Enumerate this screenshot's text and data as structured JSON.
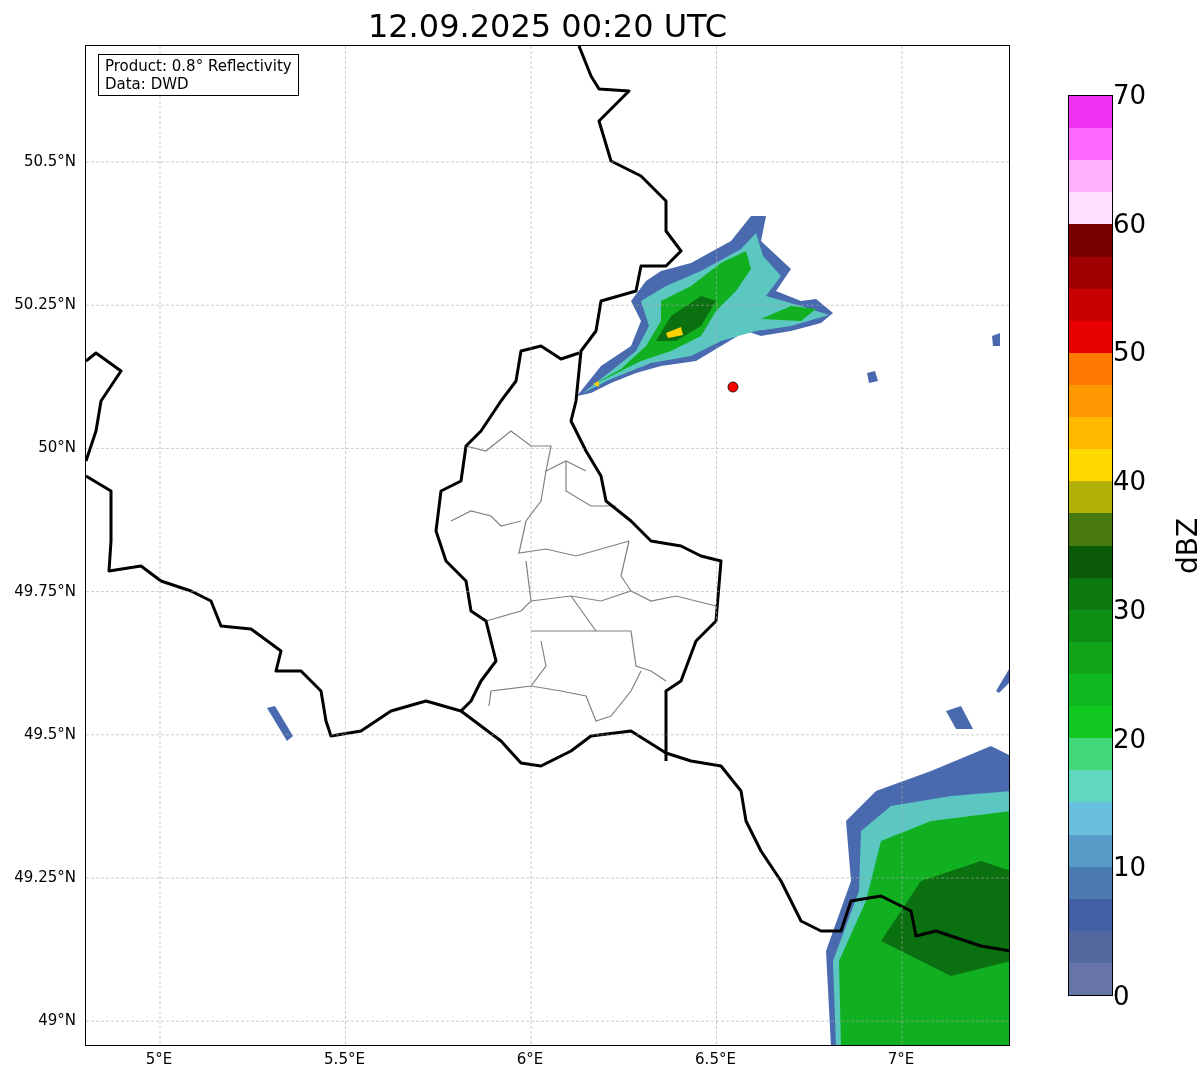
{
  "title": "12.09.2025 00:20 UTC",
  "legend": [
    "Product: 0.8° Reflectivity",
    "Data: DWD"
  ],
  "lat_ticks": [
    "50.5°N",
    "50.25°N",
    "50°N",
    "49.75°N",
    "49.5°N",
    "49.25°N",
    "49°N"
  ],
  "lon_ticks": [
    "5°E",
    "5.5°E",
    "6°E",
    "6.5°E",
    "7°E"
  ],
  "colorbar": {
    "label": "dBZ",
    "ticks": [
      "70",
      "60",
      "50",
      "40",
      "30",
      "20",
      "10",
      "0"
    ],
    "bins": [
      {
        "color": "#f030f0"
      },
      {
        "color": "#ff68ff"
      },
      {
        "color": "#ffb0ff"
      },
      {
        "color": "#ffe0ff"
      },
      {
        "color": "#780000"
      },
      {
        "color": "#a00000"
      },
      {
        "color": "#c80000"
      },
      {
        "color": "#e80000"
      },
      {
        "color": "#ff7800"
      },
      {
        "color": "#ff9800"
      },
      {
        "color": "#ffb800"
      },
      {
        "color": "#ffd800"
      },
      {
        "color": "#b0b008"
      },
      {
        "color": "#487810"
      },
      {
        "color": "#0a5a0a"
      },
      {
        "color": "#0c7a10"
      },
      {
        "color": "#0e8e14"
      },
      {
        "color": "#10a418"
      },
      {
        "color": "#10b820"
      },
      {
        "color": "#10c820"
      },
      {
        "color": "#40d878"
      },
      {
        "color": "#60d8c0"
      },
      {
        "color": "#68c0dc"
      },
      {
        "color": "#5a9cc8"
      },
      {
        "color": "#4a7ab0"
      },
      {
        "color": "#445ea6"
      },
      {
        "color": "#5468a0"
      },
      {
        "color": "#6674a8"
      }
    ]
  }
}
